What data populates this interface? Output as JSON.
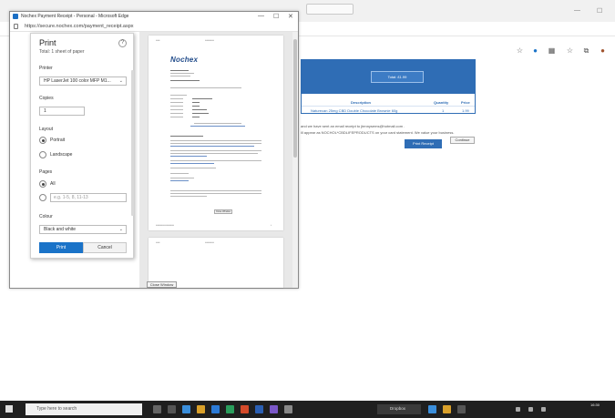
{
  "window": {
    "title": "Nochex Payment Receipt - Personal - Microsoft Edge",
    "url": "https://secure.nochex.com/payment_receipt.aspx",
    "minimize": "—",
    "maximize": "☐",
    "close": "✕"
  },
  "background": {
    "total_label": "Total: £1.99",
    "columns": [
      "Description",
      "Quantity",
      "Price"
    ],
    "row": {
      "description": "Naturecan 25mg CBD Double Chocolate Brownie 60g",
      "quantity": "1",
      "price": "1.99"
    },
    "message_1": "and we have sent an email receipt to jtennysems@hotmail.com .",
    "message_2": "ill appear as NOCHOL*CBDLIFEPRODUCTS on your card statement. We value your business.",
    "print_receipt": "Print Receipt",
    "continue": "Continue"
  },
  "print_panel": {
    "title": "Print",
    "subtitle": "Total: 1 sheet of paper",
    "help": "?",
    "printer_label": "Printer",
    "printer_value": "HP LaserJet 100 color MFP M1...",
    "copies_label": "Copies",
    "copies_value": "1",
    "layout_label": "Layout",
    "layout_options": [
      "Portrait",
      "Landscape"
    ],
    "pages_label": "Pages",
    "pages_all": "All",
    "pages_placeholder": "e.g. 1-5, 8, 11-13",
    "colour_label": "Colour",
    "colour_value": "Black and white",
    "print_button": "Print",
    "cancel_button": "Cancel"
  },
  "preview": {
    "logo": "Nochex",
    "close_window": "Close Window",
    "inner_close_window": "Close Window"
  },
  "taskbar": {
    "search_placeholder": "Type here to search",
    "dropbox": "Dropbox",
    "time": "16:30"
  },
  "colors": {
    "accent": "#1a73c8",
    "nochex_blue": "#2f6db5"
  }
}
